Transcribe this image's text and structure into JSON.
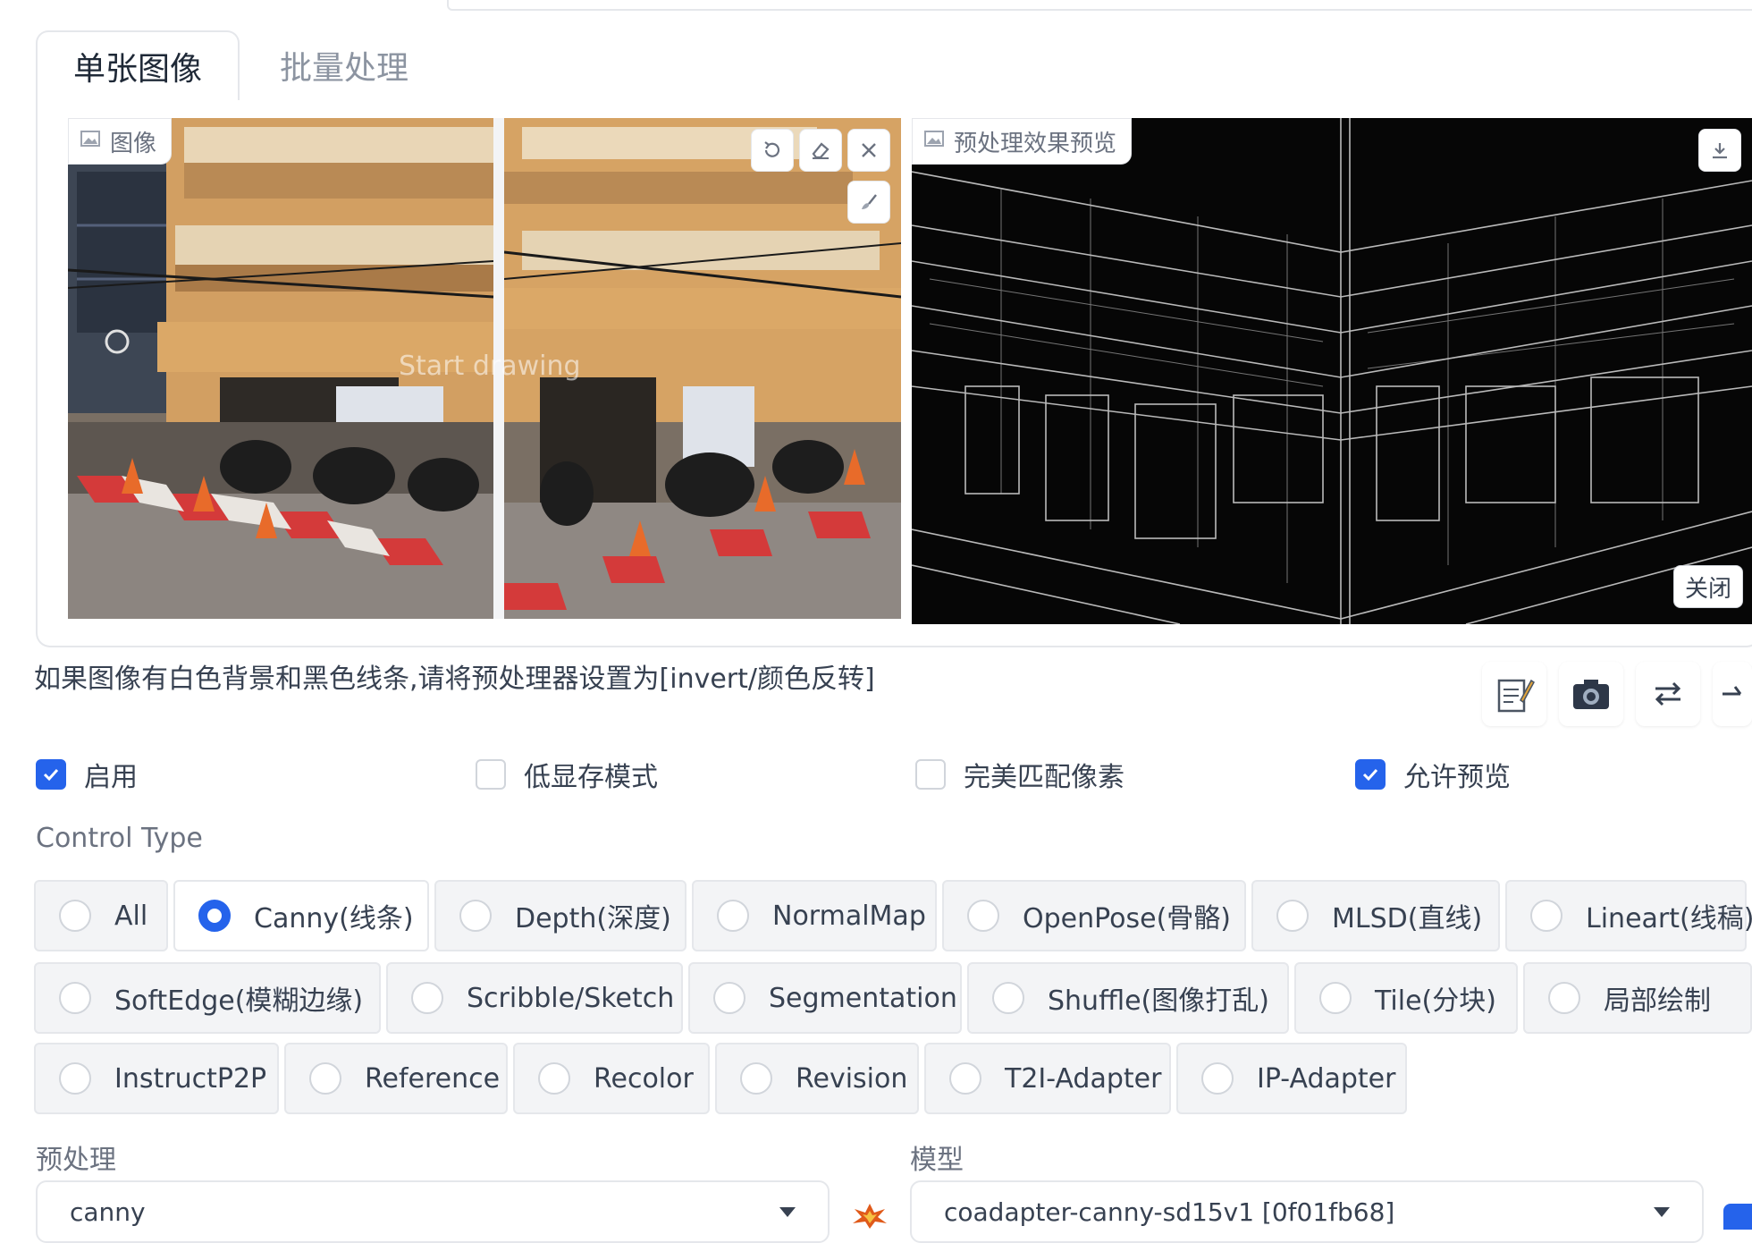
{
  "tabs": [
    {
      "label": "单张图像",
      "active": true
    },
    {
      "label": "批量处理",
      "active": false
    }
  ],
  "input_image": {
    "label": "图像",
    "canvas_hint": "Start drawing",
    "tools": [
      "undo-icon",
      "eraser-icon",
      "close-icon",
      "brush-icon"
    ]
  },
  "preview_image": {
    "label": "预处理效果预览",
    "close_label": "关闭",
    "download_icon": "download-icon"
  },
  "hint_text": "如果图像有白色背景和黑色线条,请将预处理器设置为[invert/颜色反转]",
  "action_icons": [
    "edit-icon",
    "camera-icon",
    "swap-icon",
    "arrow-up-icon"
  ],
  "checkboxes": [
    {
      "label": "启用",
      "checked": true
    },
    {
      "label": "低显存模式",
      "checked": false
    },
    {
      "label": "完美匹配像素",
      "checked": false
    },
    {
      "label": "允许预览",
      "checked": true
    }
  ],
  "control_type": {
    "label": "Control Type",
    "options": [
      [
        "All",
        "Canny(线条)",
        "Depth(深度)",
        "NormalMap",
        "OpenPose(骨骼)",
        "MLSD(直线)",
        "Lineart(线稿)"
      ],
      [
        "SoftEdge(模糊边缘)",
        "Scribble/Sketch",
        "Segmentation",
        "Shuffle(图像打乱)",
        "Tile(分块)",
        "局部绘制"
      ],
      [
        "InstructP2P",
        "Reference",
        "Recolor",
        "Revision",
        "T2I-Adapter",
        "IP-Adapter"
      ]
    ],
    "selected": "Canny(线条)"
  },
  "preprocessor": {
    "label": "预处理",
    "value": "canny"
  },
  "model": {
    "label": "模型",
    "value": "coadapter-canny-sd15v1 [0f01fb68]"
  },
  "colors": {
    "accent": "#2563eb",
    "border": "#e5e7eb",
    "radio_bg": "#f3f4f6"
  }
}
